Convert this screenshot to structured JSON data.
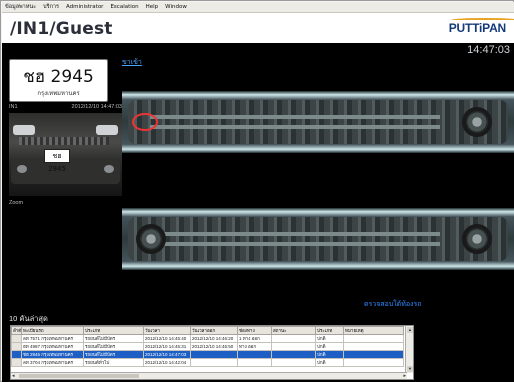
{
  "menu": [
    "ข้อมูลพาหนะ",
    "บริการ",
    "Administrator",
    "Escalation",
    "Help",
    "Window"
  ],
  "header": {
    "title": "/IN1/Guest",
    "logo": "PUTTiPAN"
  },
  "clock": "14:47:03",
  "direction_label": "ขาเข้า",
  "plate": {
    "number": "ชฮ 2945",
    "province": "กรุงเทพมหานคร"
  },
  "camera": {
    "id": "IN1",
    "timestamp": "2012/12/10 14:47:03"
  },
  "photo_plate": "ชฮ 2945",
  "zoom_label": "Zoom",
  "verify_link": "ตรวจสอบใต้ท้องรถ",
  "list": {
    "title": "10 คันล่าสุด",
    "columns": [
      "ลำดับ",
      "ทะเบียนรถ",
      "ประเภท",
      "วันเวลา",
      "วันเวลาออก",
      "ช่องทาง",
      "สถานะ",
      "ประเภท",
      "หมายเหตุ"
    ],
    "rows": [
      [
        "",
        "ลท 7571 กรุงเทพมหานคร",
        "รถยนต์ไม่มีบัตร",
        "2012/12/10 14:45:40",
        "2012/12/10 14:46:20",
        "1 ทาง ออก",
        "",
        "ปกติ",
        ""
      ],
      [
        "",
        "ฮท 4987 กรุงเทพมหานคร",
        "รถยนต์ไม่มีบัตร",
        "2012/12/10 14:45:31",
        "2012/12/10 14:46:50",
        "ทาง ออก",
        "",
        "ปกติ",
        ""
      ],
      [
        "",
        "ชฮ 2945 กรุงเทพมหานคร",
        "รถยนต์ไม่มีบัตร",
        "2012/12/10 14:47:03",
        "",
        "",
        "",
        "ปกติ",
        ""
      ],
      [
        "",
        "ลท 3704 กรุงเทพมหานคร",
        "รถยนต์ทั่วไป",
        "2012/12/10 14:42:04",
        "",
        "",
        "",
        "ปกติ",
        ""
      ]
    ],
    "selected_row": 2
  }
}
